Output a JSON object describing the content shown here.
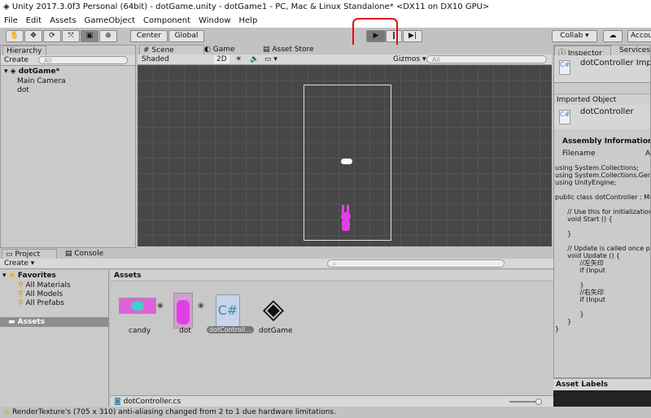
{
  "window": {
    "title": "Unity 2017.3.0f3 Personal (64bit) - dotGame.unity - dotGame1 - PC, Mac & Linux Standalone* <DX11 on DX10 GPU>"
  },
  "menu": [
    "File",
    "Edit",
    "Assets",
    "GameObject",
    "Component",
    "Window",
    "Help"
  ],
  "toolbar": {
    "tools": [
      "hand-tool",
      "move-tool",
      "rotate-tool",
      "scale-tool",
      "rect-tool",
      "transform-tool"
    ],
    "pivot": "Center",
    "space": "Global",
    "collab": "Collab",
    "account": "Account"
  },
  "hierarchy": {
    "tab": "Hierarchy",
    "create": "Create",
    "search_placeholder": "All",
    "scene": "dotGame*",
    "items": [
      "Main Camera",
      "dot"
    ]
  },
  "scene": {
    "tabs": [
      "Scene",
      "Game",
      "Asset Store"
    ],
    "shading": "Shaded",
    "mode_2d": "2D",
    "gizmos": "Gizmos",
    "search_placeholder": "All"
  },
  "inspector": {
    "tabs": [
      "Inspector",
      "Services"
    ],
    "header": "dotController Import Settings",
    "imported_object": "Imported Object",
    "object_name": "dotController",
    "assembly": "Assembly Information",
    "filename": "Filename",
    "filename_val": "A",
    "asset_labels": "Asset Labels",
    "code": "using System.Collections;\nusing System.Collections.Generic;\nusing UnityEngine;\n\npublic class dotController : MonoBehaviour {\n\n\t// Use this for initialization\n\tvoid Start () {\n\n\t}\n\n\t// Update is called once per frame\n\tvoid Update () {\n\t\t//左矢印\n\t\tif (Input\n\n\t\t}\n\t\t//右矢印\n\t\tif (Input\n\n\t\t}\n\t}\n}"
  },
  "project": {
    "tabs": [
      "Project",
      "Console"
    ],
    "create": "Create",
    "favorites": "Favorites",
    "fav_items": [
      "All Materials",
      "All Models",
      "All Prefabs"
    ],
    "assets_folder": "Assets",
    "breadcrumb": "Assets",
    "assets": [
      {
        "name": "candy"
      },
      {
        "name": "dot"
      },
      {
        "name": "dotControll..."
      },
      {
        "name": "dotGame"
      }
    ],
    "selected_file": "dotController.cs"
  },
  "status": {
    "message": "RenderTexture's (705 x 310) anti-aliasing changed from 2 to 1 due hardware limitations."
  }
}
